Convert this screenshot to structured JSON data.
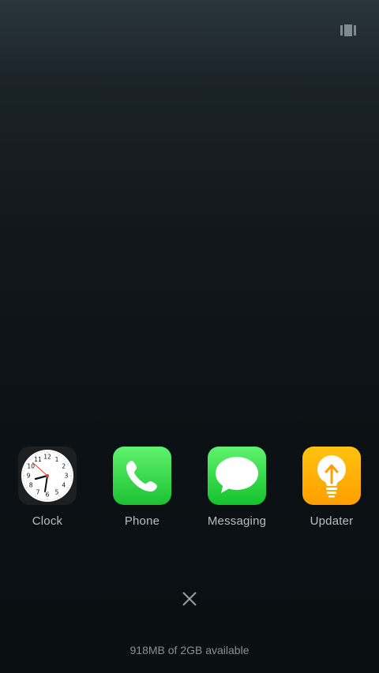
{
  "header": {
    "layout_toggle_icon": "multi-window-icon"
  },
  "apps": [
    {
      "label": "Clock",
      "icon": "clock-icon"
    },
    {
      "label": "Phone",
      "icon": "phone-icon"
    },
    {
      "label": "Messaging",
      "icon": "message-bubble-icon"
    },
    {
      "label": "Updater",
      "icon": "lightbulb-icon"
    }
  ],
  "clock_face": {
    "numbers": [
      "12",
      "1",
      "2",
      "3",
      "4",
      "5",
      "6",
      "7",
      "8",
      "9",
      "10",
      "11"
    ]
  },
  "footer": {
    "close_icon": "close-icon",
    "memory_text": "918MB of 2GB available"
  },
  "colors": {
    "background_top": "#2a353c",
    "background_bottom": "#0a0f12",
    "label_text": "#b9bec1",
    "memory_text": "#8a9094",
    "phone_green": "#1cc132",
    "updater_orange": "#ff9f00"
  }
}
